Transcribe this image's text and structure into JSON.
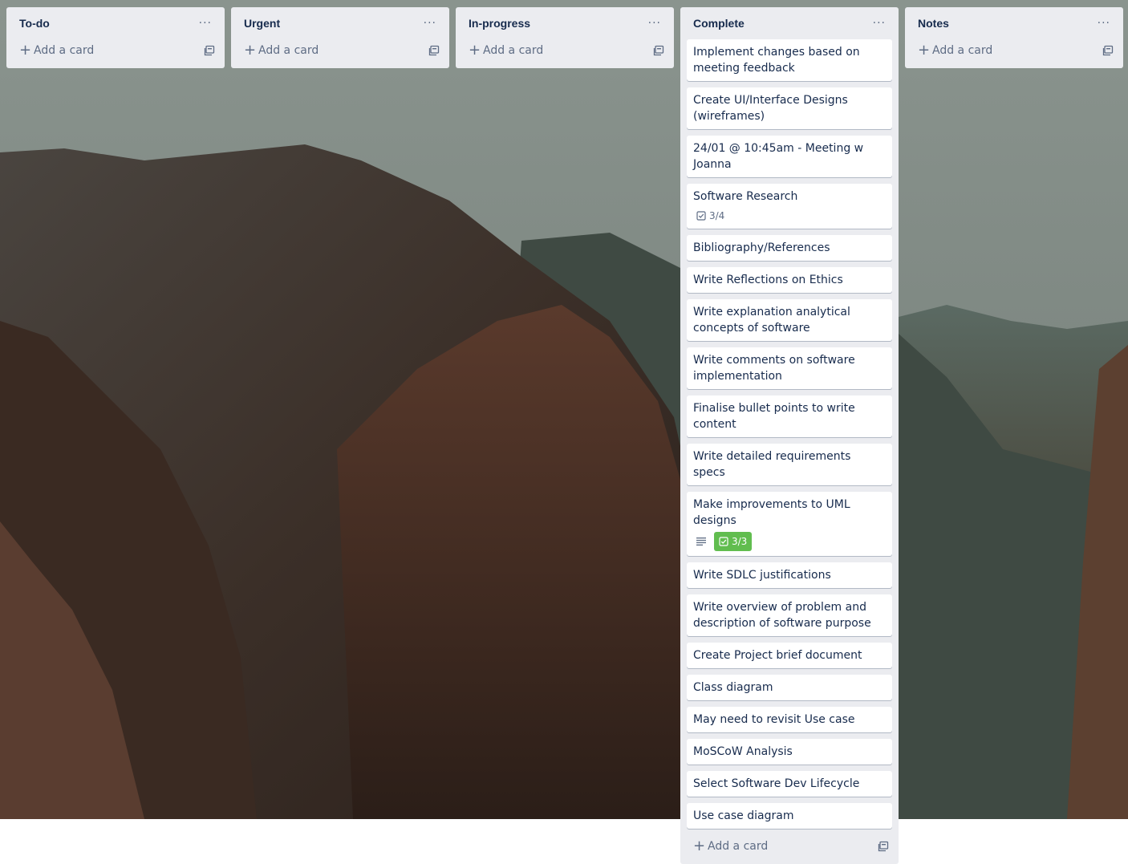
{
  "lists": [
    {
      "title": "To-do",
      "cards": [],
      "add_label": "Add a card"
    },
    {
      "title": "Urgent",
      "cards": [],
      "add_label": "Add a card"
    },
    {
      "title": "In-progress",
      "cards": [],
      "add_label": "Add a card"
    },
    {
      "title": "Complete",
      "add_label": "Add a card",
      "cards": [
        {
          "title": "Implement changes based on meeting feedback"
        },
        {
          "title": "Create UI/Interface Designs (wireframes)"
        },
        {
          "title": "24/01 @ 10:45am - Meeting w Joanna"
        },
        {
          "title": "Software Research",
          "checklist": "3/4"
        },
        {
          "title": "Bibliography/References"
        },
        {
          "title": "Write Reflections on Ethics"
        },
        {
          "title": "Write explanation analytical concepts of software"
        },
        {
          "title": "Write comments on software implementation"
        },
        {
          "title": "Finalise bullet points to write content"
        },
        {
          "title": "Write detailed requirements specs"
        },
        {
          "title": "Make improvements to UML designs",
          "checklist": "3/3",
          "has_description": true
        },
        {
          "title": "Write SDLC justifications"
        },
        {
          "title": "Write overview of problem and description of software purpose"
        },
        {
          "title": "Create Project brief document"
        },
        {
          "title": "Class diagram"
        },
        {
          "title": "May need to revisit Use case"
        },
        {
          "title": "MoSCoW Analysis"
        },
        {
          "title": "Select Software Dev Lifecycle"
        },
        {
          "title": "Use case diagram"
        }
      ]
    },
    {
      "title": "Notes",
      "cards": [],
      "add_label": "Add a card"
    }
  ],
  "icons": {
    "list_menu": "ellipsis-icon",
    "add": "plus-icon",
    "template": "card-template-icon",
    "checklist": "checklist-icon",
    "description": "description-icon"
  },
  "colors": {
    "list_bg": "#ebecf0",
    "card_bg": "#ffffff",
    "checklist_complete": "#61bd4f",
    "text": "#172b4d",
    "muted": "#5e6c84"
  }
}
